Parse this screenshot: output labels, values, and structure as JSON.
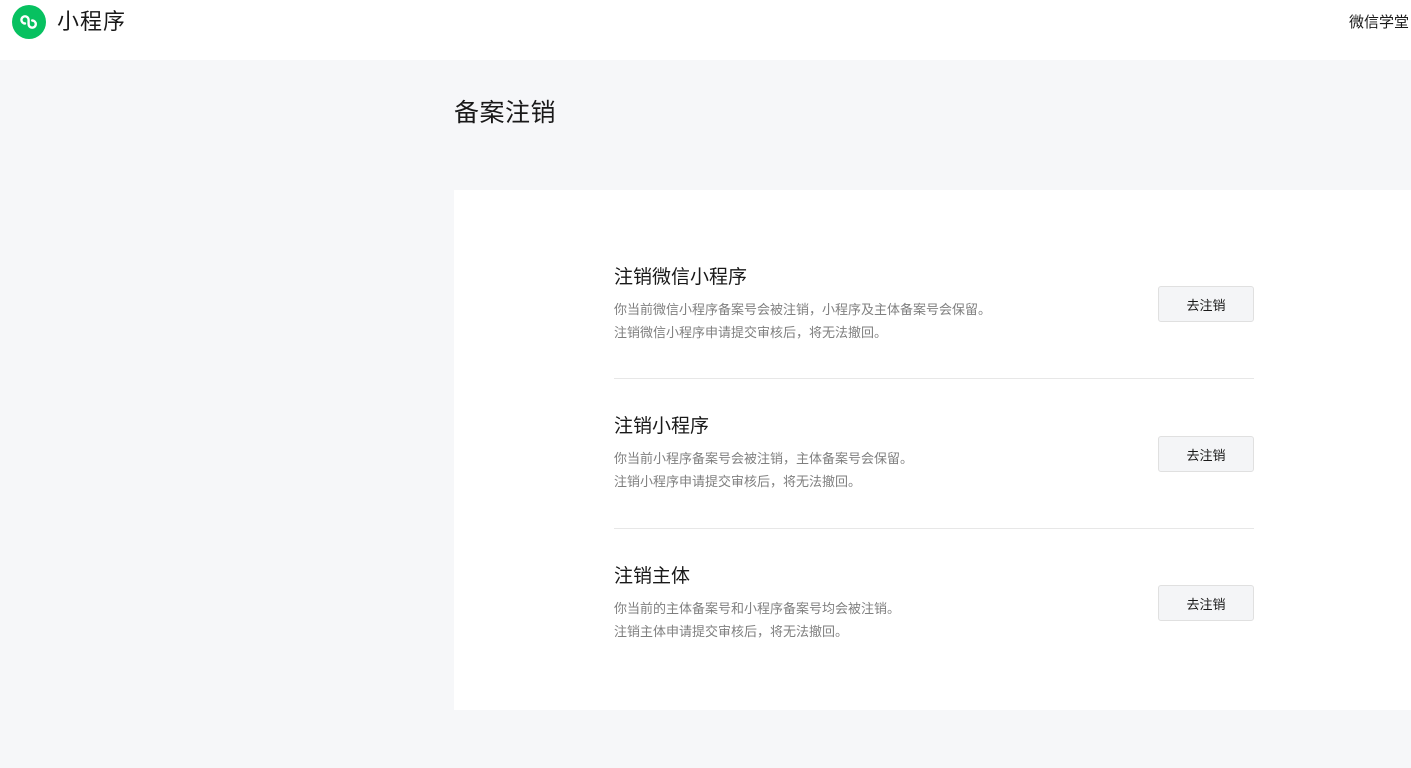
{
  "header": {
    "logo_icon": "mini-program-link-icon",
    "logo_color": "#07c160",
    "logo_text": "小程序",
    "top_right_link": "微信学堂"
  },
  "page": {
    "title": "备案注销"
  },
  "options": [
    {
      "title": "注销微信小程序",
      "desc_line1": "你当前微信小程序备案号会被注销，小程序及主体备案号会保留。",
      "desc_line2": "注销微信小程序申请提交审核后，将无法撤回。",
      "button_label": "去注销"
    },
    {
      "title": "注销小程序",
      "desc_line1": "你当前小程序备案号会被注销，主体备案号会保留。",
      "desc_line2": "注销小程序申请提交审核后，将无法撤回。",
      "button_label": "去注销"
    },
    {
      "title": "注销主体",
      "desc_line1": "你当前的主体备案号和小程序备案号均会被注销。",
      "desc_line2": "注销主体申请提交审核后，将无法撤回。",
      "button_label": "去注销"
    }
  ]
}
